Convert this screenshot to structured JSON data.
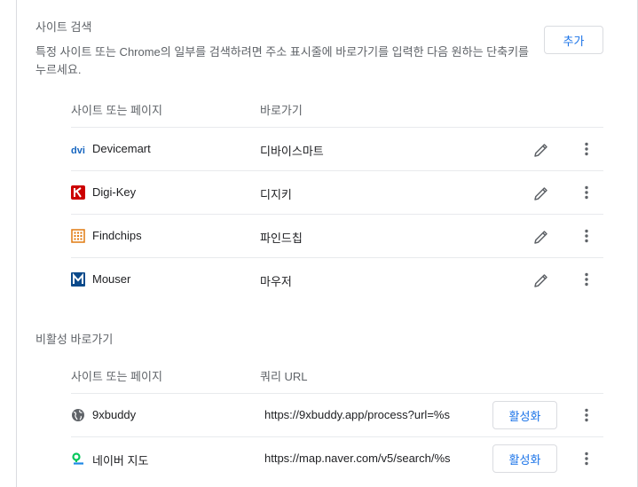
{
  "site_search": {
    "title": "사이트 검색",
    "description": "특정 사이트 또는 Chrome의 일부를 검색하려면 주소 표시줄에 바로가기를 입력한 다음 원하는 단축키를 누르세요.",
    "add_button_label": "추가",
    "columns": {
      "site": "사이트 또는 페이지",
      "shortcut": "바로가기"
    },
    "rows": [
      {
        "site": "Devicemart",
        "shortcut": "디바이스마트",
        "favicon": "devicemart-logo-icon"
      },
      {
        "site": "Digi-Key",
        "shortcut": "디지키",
        "favicon": "digikey-logo-icon"
      },
      {
        "site": "Findchips",
        "shortcut": "파인드칩",
        "favicon": "findchips-logo-icon"
      },
      {
        "site": "Mouser",
        "shortcut": "마우저",
        "favicon": "mouser-logo-icon"
      }
    ]
  },
  "inactive_shortcuts": {
    "title": "비활성 바로가기",
    "columns": {
      "site": "사이트 또는 페이지",
      "query_url": "쿼리 URL"
    },
    "activate_label": "활성화",
    "rows": [
      {
        "site": "9xbuddy",
        "url": "https://9xbuddy.app/process?url=%s",
        "favicon": "globe-icon"
      },
      {
        "site": "네이버 지도",
        "url": "https://map.naver.com/v5/search/%s",
        "favicon": "naver-map-logo-icon"
      }
    ]
  },
  "colors": {
    "accent": "#1a73e8",
    "secondary_text": "#5f6368",
    "primary_text": "#202124",
    "divider": "#e8eaed",
    "border": "#dadce0"
  }
}
